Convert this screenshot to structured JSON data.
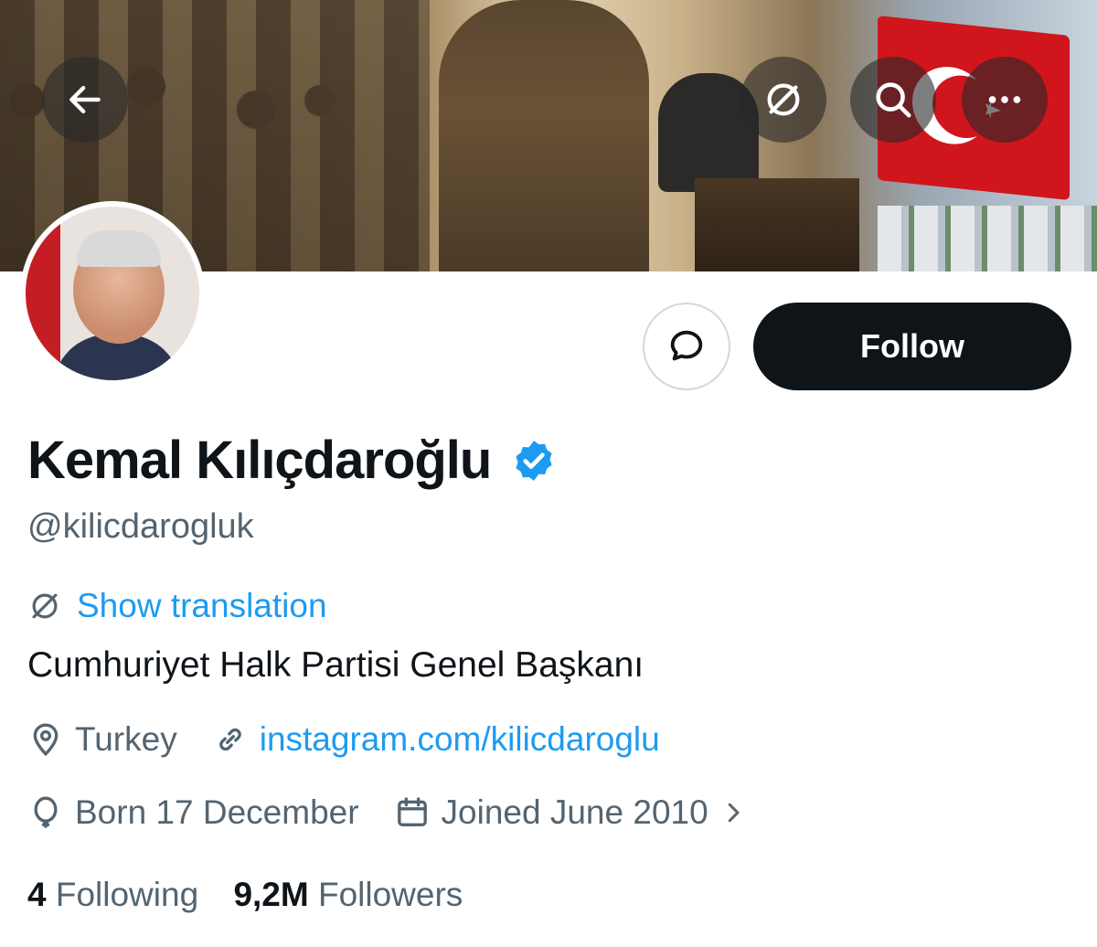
{
  "header": {
    "back_icon": "arrow-left-icon",
    "translate_icon": "translate-icon",
    "search_icon": "search-icon",
    "more_icon": "more-horizontal-icon"
  },
  "profile": {
    "name": "Kemal Kılıçdaroğlu",
    "verified_icon": "verified-badge-icon",
    "handle": "@kilicdarogluk",
    "show_translation": "Show translation",
    "bio": "Cumhuriyet Halk Partisi Genel Başkanı",
    "location": "Turkey",
    "website": "instagram.com/kilicdaroglu",
    "birthday": "Born 17 December",
    "joined": "Joined June 2010",
    "following_count": "4",
    "following_label": "Following",
    "followers_count": "9,2M",
    "followers_label": "Followers"
  },
  "actions": {
    "message_icon": "message-bubble-icon",
    "follow_label": "Follow"
  },
  "colors": {
    "accent": "#1d9bf0",
    "primary_text": "#0f1419",
    "secondary_text": "#536471",
    "follow_bg": "#0f1419"
  }
}
